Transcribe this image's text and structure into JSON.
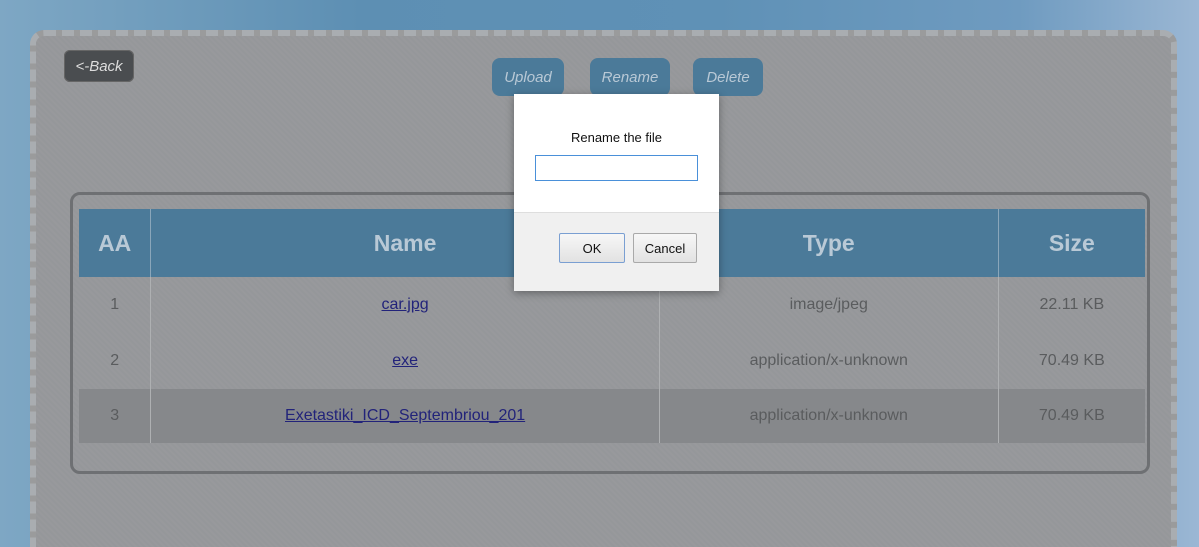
{
  "toolbar": {
    "back_label": "<-Back",
    "upload_label": "Upload",
    "rename_label": "Rename",
    "delete_label": "Delete"
  },
  "table": {
    "headers": [
      "AA",
      "Name",
      "Type",
      "Size"
    ],
    "rows": [
      {
        "aa": "1",
        "name": "car.jpg",
        "type": "image/jpeg",
        "size": "22.11 KB"
      },
      {
        "aa": "2",
        "name": "exe",
        "type": "application/x-unknown",
        "size": "70.49 KB"
      },
      {
        "aa": "3",
        "name": "Exetastiki_ICD_Septembriou_201",
        "type": "application/x-unknown",
        "size": "70.49 KB"
      }
    ]
  },
  "dialog": {
    "message": "Rename the file",
    "input_value": "",
    "ok_label": "OK",
    "cancel_label": "Cancel"
  },
  "colors": {
    "accent": "#4b7a99",
    "link": "#22237a"
  }
}
